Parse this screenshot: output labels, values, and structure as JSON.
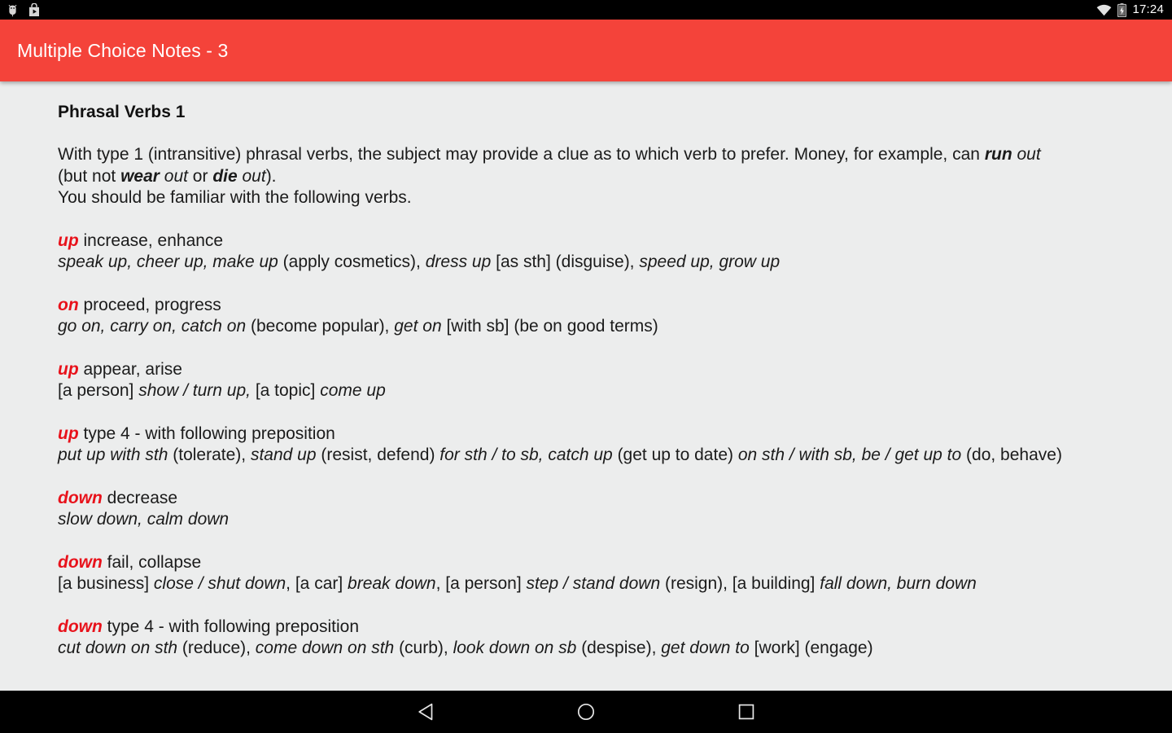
{
  "status_bar": {
    "icons_left": [
      "android-debug-icon",
      "play-store-icon"
    ],
    "icons_right": [
      "wifi-icon",
      "battery-charging-icon"
    ],
    "clock": "17:24"
  },
  "app_bar": {
    "title": "Multiple Choice Notes - 3",
    "background_color": "#F4433A",
    "title_color": "#FFFFFF"
  },
  "note": {
    "title": "Phrasal Verbs 1",
    "accent_color": "#E8121B",
    "background_color": "#ECEDED",
    "intro": {
      "line1_a": "With type 1 (intransitive) phrasal verbs, the subject may provide a clue as to which verb to prefer. Money, for example, can ",
      "line1_bi": "run",
      "line1_it": " out",
      "line2_a": "(but not ",
      "line2_bi1": "wear",
      "line2_it1": " out",
      "line2_b": " or ",
      "line2_bi2": "die",
      "line2_it2": " out",
      "line2_c": ").",
      "line3": "You should be familiar with the following verbs."
    },
    "entries": [
      {
        "keyword": "up",
        "gloss": " increase, enhance",
        "examples_it1": "speak up, cheer up, make up",
        "examples_rest": " (apply cosmetics), ",
        "examples_it2": "dress up",
        "examples_rest2": " [as sth] (disguise), ",
        "examples_it3": "speed up, grow up",
        "examples_rest3": ""
      },
      {
        "keyword": "on",
        "gloss": " proceed, progress",
        "examples_it1": "go on, carry on, catch on",
        "examples_rest": " (become popular), ",
        "examples_it2": "get on",
        "examples_rest2": " [with sb] (be on good terms)",
        "examples_it3": "",
        "examples_rest3": ""
      },
      {
        "keyword": "up",
        "gloss": " appear, arise",
        "examples_it1": "",
        "examples_rest": "[a person] ",
        "examples_it2": "show / turn up,",
        "examples_rest2": " [a topic] ",
        "examples_it3": "come up",
        "examples_rest3": ""
      },
      {
        "keyword": "up",
        "gloss": " type 4 - with following preposition",
        "examples_it1": "put up with sth",
        "examples_rest": " (tolerate), ",
        "examples_it2": "stand up",
        "examples_rest2": " (resist, defend) ",
        "examples_it3": "for sth / to sb, catch up",
        "examples_rest3": " (get up to date) ",
        "examples_it4": "on sth / with sb, be / get up to",
        "examples_rest4": " (do, behave)"
      },
      {
        "keyword": "down",
        "gloss": " decrease",
        "examples_it1": "slow down, calm down",
        "examples_rest": "",
        "examples_it2": "",
        "examples_rest2": "",
        "examples_it3": "",
        "examples_rest3": ""
      },
      {
        "keyword": "down",
        "gloss": " fail, collapse",
        "examples_it1": "",
        "examples_rest": "[a business] ",
        "examples_it2": "close / shut down",
        "examples_rest2": ", [a car] ",
        "examples_it3": "break down",
        "examples_rest3": ", [a person] ",
        "examples_it4": "step / stand down",
        "examples_rest4": " (resign), [a building] ",
        "examples_it5": "fall down, burn down",
        "examples_rest5": ""
      },
      {
        "keyword": "down",
        "gloss": " type 4 - with following preposition",
        "examples_it1": "cut down on sth",
        "examples_rest": " (reduce), ",
        "examples_it2": "come down on sth",
        "examples_rest2": " (curb), ",
        "examples_it3": "look down on sb",
        "examples_rest3": " (despise), ",
        "examples_it4": "get down to",
        "examples_rest4": " [work] (engage)"
      }
    ]
  },
  "nav_bar": {
    "buttons": [
      "back-button",
      "home-button",
      "recents-button"
    ]
  }
}
